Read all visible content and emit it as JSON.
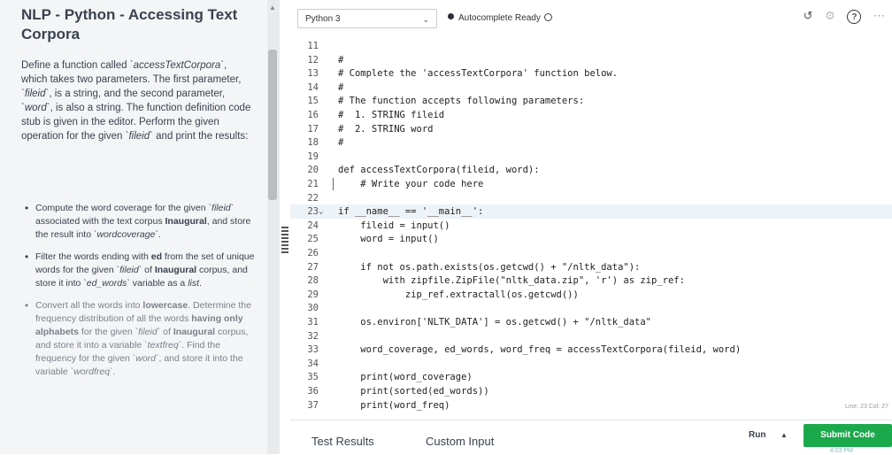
{
  "problem": {
    "title": "NLP - Python - Accessing Text Corpora",
    "description": [
      {
        "text": "Define a function called",
        "style": ""
      },
      {
        "text": "`accessTextCorpora`",
        "style": "italic"
      },
      {
        "text": ", which takes two parameters. The first parameter, `",
        "style": ""
      },
      {
        "text": "fileid",
        "style": "italic"
      },
      {
        "text": "`, is a string, and the second parameter, `",
        "style": ""
      },
      {
        "text": "word",
        "style": "italic"
      },
      {
        "text": "`, is also a string. The function definition code stub is given in the editor. Perform the given operation for the given `",
        "style": ""
      },
      {
        "text": "fileid",
        "style": "italic"
      },
      {
        "text": "` and print the results:",
        "style": ""
      }
    ],
    "bullets": [
      {
        "parts": [
          {
            "text": "Compute the word coverage for the given ",
            "style": ""
          },
          {
            "text": "`fileid`",
            "style": "italic"
          },
          {
            "text": " associated with the text corpus ",
            "style": ""
          },
          {
            "text": "Inaugural",
            "style": "bold"
          },
          {
            "text": ", and store the result into ",
            "style": ""
          },
          {
            "text": "`wordcoverage`",
            "style": "italic"
          },
          {
            "text": ".",
            "style": ""
          }
        ]
      },
      {
        "parts": [
          {
            "text": "Filter the words ending with ",
            "style": ""
          },
          {
            "text": "ed",
            "style": "bold"
          },
          {
            "text": " from the set of unique words for the given ",
            "style": ""
          },
          {
            "text": "`fileid`",
            "style": "italic"
          },
          {
            "text": " of ",
            "style": ""
          },
          {
            "text": "Inaugural",
            "style": "bold"
          },
          {
            "text": " corpus, and store it into ",
            "style": ""
          },
          {
            "text": "`ed_words`",
            "style": "italic"
          },
          {
            "text": " variable as a ",
            "style": ""
          },
          {
            "text": "list",
            "style": "italic"
          },
          {
            "text": ".",
            "style": ""
          }
        ]
      },
      {
        "parts": [
          {
            "text": "Convert all the words into ",
            "style": ""
          },
          {
            "text": "lowercase",
            "style": "bold"
          },
          {
            "text": ". Determine the frequency distribution of all the words ",
            "style": ""
          },
          {
            "text": "having only alphabets",
            "style": "bold"
          },
          {
            "text": " for the given ",
            "style": ""
          },
          {
            "text": "`fileid`",
            "style": "italic"
          },
          {
            "text": " of ",
            "style": ""
          },
          {
            "text": "Inaugural",
            "style": "bold"
          },
          {
            "text": " corpus, and store it into a variable ",
            "style": ""
          },
          {
            "text": "`textfreq`",
            "style": "italic"
          },
          {
            "text": ". Find the frequency for the given ",
            "style": ""
          },
          {
            "text": "`word`",
            "style": "italic"
          },
          {
            "text": ", and store it into the variable ",
            "style": ""
          },
          {
            "text": "`wordfreq`",
            "style": "italic"
          },
          {
            "text": ".",
            "style": ""
          }
        ]
      }
    ]
  },
  "toolbar": {
    "language": "Python 3",
    "status": "Autocomplete Ready"
  },
  "editor": {
    "lines": [
      {
        "n": "11",
        "code": ""
      },
      {
        "n": "12",
        "code": "#"
      },
      {
        "n": "13",
        "code": "# Complete the 'accessTextCorpora' function below."
      },
      {
        "n": "14",
        "code": "#"
      },
      {
        "n": "15",
        "code": "# The function accepts following parameters:"
      },
      {
        "n": "16",
        "code": "#  1. STRING fileid"
      },
      {
        "n": "17",
        "code": "#  2. STRING word"
      },
      {
        "n": "18",
        "code": "#"
      },
      {
        "n": "19",
        "code": ""
      },
      {
        "n": "20",
        "code": "def accessTextCorpora(fileid, word):"
      },
      {
        "n": "21",
        "code": "    # Write your code here"
      },
      {
        "n": "22",
        "code": ""
      },
      {
        "n": "23",
        "code": "if __name__ == '__main__':"
      },
      {
        "n": "24",
        "code": "    fileid = input()"
      },
      {
        "n": "25",
        "code": "    word = input()"
      },
      {
        "n": "26",
        "code": ""
      },
      {
        "n": "27",
        "code": "    if not os.path.exists(os.getcwd() + \"/nltk_data\"):"
      },
      {
        "n": "28",
        "code": "        with zipfile.ZipFile(\"nltk_data.zip\", 'r') as zip_ref:"
      },
      {
        "n": "29",
        "code": "            zip_ref.extractall(os.getcwd())"
      },
      {
        "n": "30",
        "code": ""
      },
      {
        "n": "31",
        "code": "    os.environ['NLTK_DATA'] = os.getcwd() + \"/nltk_data\""
      },
      {
        "n": "32",
        "code": ""
      },
      {
        "n": "33",
        "code": "    word_coverage, ed_words, word_freq = accessTextCorpora(fileid, word)"
      },
      {
        "n": "34",
        "code": ""
      },
      {
        "n": "35",
        "code": "    print(word_coverage)"
      },
      {
        "n": "36",
        "code": "    print(sorted(ed_words))"
      },
      {
        "n": "37",
        "code": "    print(word_freq)"
      }
    ],
    "cursor_position": "Line: 23 Col: 27"
  },
  "bottom": {
    "tab_test_results": "Test Results",
    "tab_custom_input": "Custom Input",
    "run_label": "Run",
    "submit_label": "Submit Code",
    "clock": "4:03 PM"
  }
}
